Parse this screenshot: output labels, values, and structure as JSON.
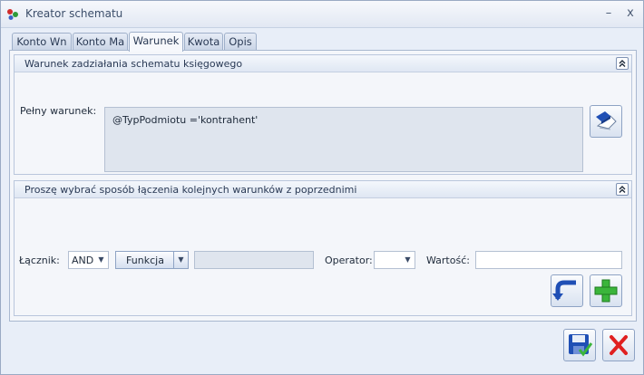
{
  "window": {
    "title": "Kreator schematu",
    "minimize_label": "–",
    "close_label": "x"
  },
  "tabs": [
    {
      "label": "Konto Wn"
    },
    {
      "label": "Konto Ma"
    },
    {
      "label": "Warunek"
    },
    {
      "label": "Kwota"
    },
    {
      "label": "Opis"
    }
  ],
  "active_tab": "Warunek",
  "group1": {
    "title": "Warunek zadziałania schematu księgowego",
    "full_condition_label": "Pełny warunek:",
    "full_condition_value": "@TypPodmiotu ='kontrahent'"
  },
  "group2": {
    "title": "Proszę wybrać sposób łączenia kolejnych warunków z poprzednimi",
    "connector_label": "Łącznik:",
    "connector_value": "AND",
    "function_button_label": "Funkcja",
    "operator_label": "Operator:",
    "operator_value": "",
    "value_label": "Wartość:",
    "value_value": ""
  },
  "icons": {
    "app": "app-icon",
    "edit": "edit-icon",
    "back": "back-arrow-icon",
    "add": "plus-icon",
    "save": "save-icon",
    "cancel": "cancel-icon"
  },
  "colors": {
    "accent_green": "#3bb53b",
    "cancel_red": "#e02020",
    "window_bg": "#e8eef8"
  }
}
